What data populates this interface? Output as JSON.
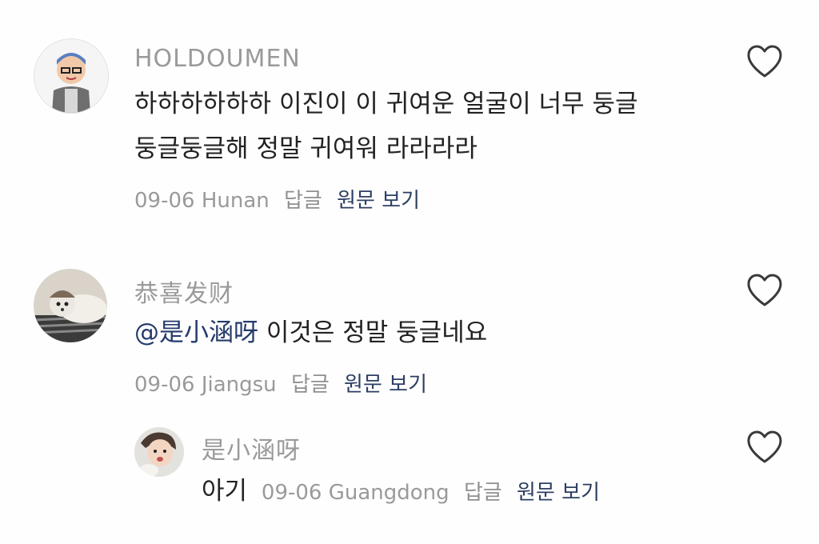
{
  "comments": [
    {
      "username": "HOLDOUMEN",
      "text_line1": "하하하하하하 이진이 이 귀여운 얼굴이 너무 둥글",
      "text_line2": "둥글둥글해 정말 귀여워 라라라라",
      "date": "09-06",
      "location": "Hunan",
      "reply_label": "답글",
      "view_original_label": "원문 보기"
    },
    {
      "username": "恭喜发财",
      "mention": "@是小涵呀",
      "text": "이것은 정말 둥글네요",
      "date": "09-06",
      "location": "Jiangsu",
      "reply_label": "답글",
      "view_original_label": "원문 보기"
    }
  ],
  "reply": {
    "username": "是小涵呀",
    "text": "아기",
    "date": "09-06",
    "location": "Guangdong",
    "reply_label": "답글",
    "view_original_label": "원문 보기"
  },
  "icons": {
    "like": "heart-outline-icon",
    "avatar": "user-avatar"
  },
  "colors": {
    "username": "#9a9a9a",
    "body": "#222222",
    "link": "#2c3e63",
    "mention": "#243b6b"
  }
}
